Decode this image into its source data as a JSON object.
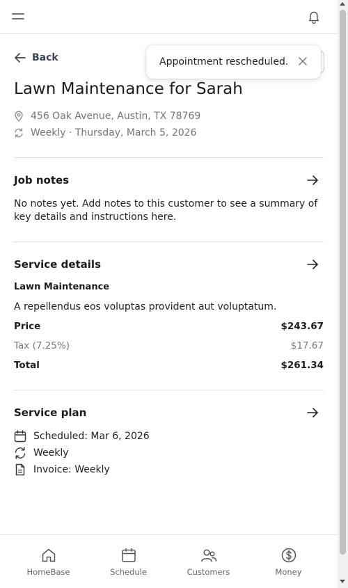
{
  "header": {
    "menu_icon": "menu-icon",
    "bell_icon": "bell-icon"
  },
  "nav": {
    "back_label": "Back"
  },
  "job": {
    "title": "Lawn Maintenance for Sarah",
    "address": "456 Oak Avenue, Austin, TX 78769",
    "recurrence": "Weekly · Thursday, March 5, 2026"
  },
  "job_notes": {
    "title": "Job notes",
    "body": "No notes yet. Add notes to this customer to see a summary of key details and instructions here."
  },
  "service_details": {
    "title": "Service details",
    "service_name": "Lawn Maintenance",
    "description": "A repellendus eos voluptas provident aut voluptatum.",
    "price_label": "Price",
    "price_value": "$243.67",
    "tax_label": "Tax (7.25%)",
    "tax_value": "$17.67",
    "total_label": "Total",
    "total_value": "$261.34"
  },
  "service_plan": {
    "title": "Service plan",
    "items": [
      {
        "icon": "calendar-icon",
        "text": "Scheduled: Mar 6, 2026"
      },
      {
        "icon": "repeat-icon",
        "text": "Weekly"
      },
      {
        "icon": "document-icon",
        "text": "Invoice: Weekly"
      }
    ]
  },
  "toast": {
    "message": "Appointment rescheduled.",
    "close_icon": "close-icon"
  },
  "bottom_nav": [
    {
      "label": "HomeBase",
      "icon": "home-icon"
    },
    {
      "label": "Schedule",
      "icon": "calendar-icon"
    },
    {
      "label": "Customers",
      "icon": "people-icon"
    },
    {
      "label": "Money",
      "icon": "dollar-icon"
    }
  ],
  "colors": {
    "text": "#1c1c1c",
    "muted": "#757575",
    "divider": "#dedede",
    "back_link": "#3a4757"
  }
}
